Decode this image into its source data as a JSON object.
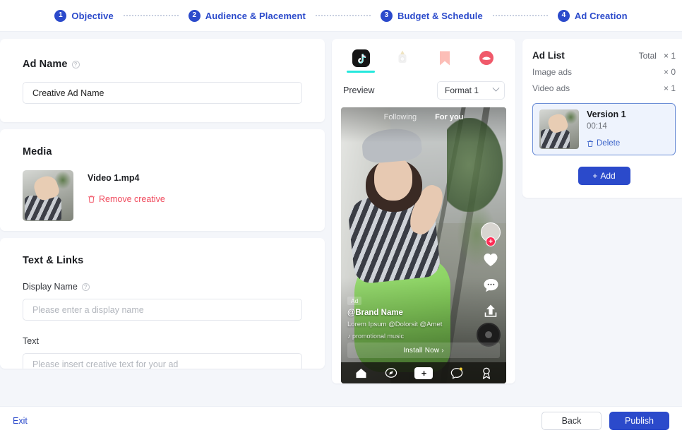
{
  "header": {
    "steps": [
      {
        "num": "1",
        "label": "Objective"
      },
      {
        "num": "2",
        "label": "Audience & Placement"
      },
      {
        "num": "3",
        "label": "Budget & Schedule"
      },
      {
        "num": "4",
        "label": "Ad Creation"
      }
    ]
  },
  "ad_name": {
    "title": "Ad Name",
    "value": "Creative Ad Name",
    "info_glyph": "?"
  },
  "media": {
    "title": "Media",
    "file_name": "Video 1.mp4",
    "remove_label": "Remove creative",
    "trash_glyph": "Ὕ1"
  },
  "text_links": {
    "title": "Text & Links",
    "display_name_label": "Display Name",
    "display_name_placeholder": "Please enter a display name",
    "text_label": "Text",
    "text_placeholder": "Please insert creative text for your ad",
    "info_glyph": "?"
  },
  "preview": {
    "platform_tabs": [
      {
        "name": "tiktok",
        "active": true
      },
      {
        "name": "topbuzz",
        "active": false
      },
      {
        "name": "helo",
        "active": false
      },
      {
        "name": "pangle",
        "active": false
      }
    ],
    "preview_label": "Preview",
    "format_value": "Format 1",
    "phone": {
      "tab_following": "Following",
      "tab_foryou": "For you",
      "ad_badge": "Ad",
      "brand": "@Brand Name",
      "description": "Lorem Ipsum @Dolorsit @Amet",
      "music": "promotional music",
      "music_glyph": "♪",
      "cta": "Install Now",
      "cta_arrow": "›",
      "avatar_plus": "+",
      "like_count": "",
      "nav_plus": "+"
    }
  },
  "ad_list": {
    "title": "Ad List",
    "total_label": "Total",
    "total_value": "× 1",
    "rows": [
      {
        "label": "Image ads",
        "value": "× 0"
      },
      {
        "label": "Video ads",
        "value": "× 1"
      }
    ],
    "item": {
      "version": "Version 1",
      "duration": "00:14",
      "delete_label": "Delete"
    },
    "add_label": "Add",
    "add_glyph": "+"
  },
  "footer": {
    "exit_label": "Exit",
    "back_label": "Back",
    "publish_label": "Publish"
  },
  "colors": {
    "brand_blue": "#2b4acb",
    "accent_teal": "#25e8dd",
    "danger_red": "#f04a5d",
    "tiktok_pink": "#fe2c55",
    "page_bg": "#f4f6fa"
  }
}
